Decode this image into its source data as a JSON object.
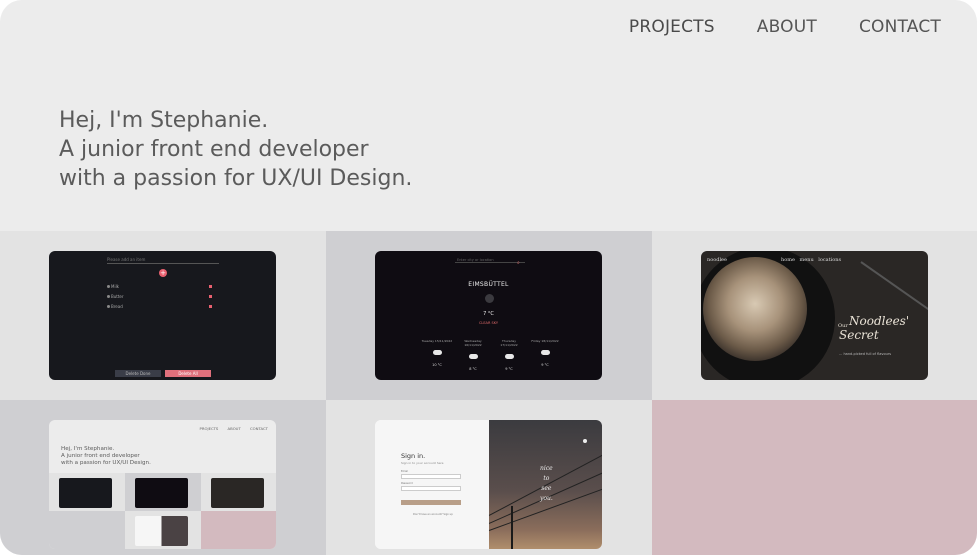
{
  "nav": {
    "items": [
      {
        "label": "PROJECTS",
        "active": true
      },
      {
        "label": "ABOUT",
        "active": false
      },
      {
        "label": "CONTACT",
        "active": false
      }
    ]
  },
  "hero": {
    "lines": [
      "Hej, I'm Stephanie.",
      "A junior front end developer",
      "with a passion for UX/UI Design."
    ]
  },
  "projects": {
    "todo": {
      "placeholder": "Please add an item",
      "items": [
        "Milk",
        "Butter",
        "Bread"
      ],
      "delete_done": "Delete Done",
      "delete_all": "Delete All"
    },
    "weather": {
      "search_placeholder": "Enter city or location",
      "city": "EIMSBÜTTEL",
      "temp": "7 °C",
      "condition": "CLEAR SKY",
      "days": [
        {
          "label": "Tuesday 15/11/2022",
          "temp": "10 °C"
        },
        {
          "label": "Wednesday 16/11/2022",
          "temp": "8 °C"
        },
        {
          "label": "Thursday 17/11/2022",
          "temp": "9 °C"
        },
        {
          "label": "Friday 18/11/2022",
          "temp": "9 °C"
        }
      ]
    },
    "noodle": {
      "brand": "noodlee",
      "menu": "home  menu  locations",
      "our": "Our",
      "title_1": "Noodlees'",
      "title_2": "Secret",
      "sub": "... hand-picked full of flavours"
    },
    "mini": {
      "nav": "PROJECTS  ABOUT  CONTACT",
      "lines": [
        "Hej, I'm Stephanie.",
        "A junior front end developer",
        "with a passion for UX/UI Design."
      ]
    },
    "signin": {
      "title": "Sign in.",
      "subtitle": "Sign in to your account here",
      "email_label": "Email",
      "password_label": "Password",
      "register": "Don't have an account? Sign up",
      "quote": [
        "nice",
        "to",
        "see",
        "you."
      ]
    }
  },
  "colors": {
    "background": "#ececec",
    "tile_light": "#e3e3e3",
    "tile_mid": "#cfcfd2",
    "tile_pink": "#d3babf",
    "text": "#5b5b5b",
    "accent_red": "#e8606f"
  }
}
